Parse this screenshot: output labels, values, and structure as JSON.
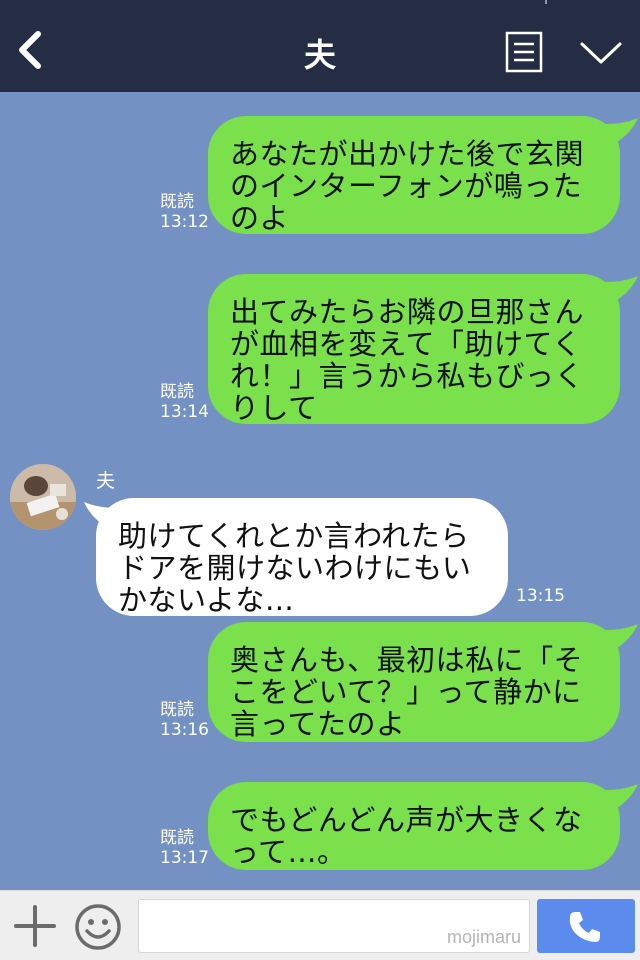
{
  "header": {
    "title": "夫",
    "back_icon": "chevron-left-icon",
    "menu_icon": "notes-menu-icon",
    "collapse_icon": "chevron-down-icon"
  },
  "messages": [
    {
      "direction": "out",
      "text": [
        "あなたが出かけた後で玄関",
        "のインターフォンが鳴った",
        "のよ"
      ],
      "read": "既読",
      "time": "13:12"
    },
    {
      "direction": "out",
      "text": [
        "出てみたらお隣の旦那さん",
        "が血相を変えて「助けてく",
        "れ！」言うから私もびっく",
        "りして"
      ],
      "read": "既読",
      "time": "13:14"
    },
    {
      "direction": "in",
      "sender": "夫",
      "text": [
        "助けてくれとか言われたら",
        "ドアを開けないわけにもい",
        "かないよな…"
      ],
      "time": "13:15"
    },
    {
      "direction": "out",
      "text": [
        "奥さんも、最初は私に「そ",
        "こをどいて？」って静かに",
        "言ってたのよ"
      ],
      "read": "既読",
      "time": "13:16"
    },
    {
      "direction": "out",
      "text": [
        "でもどんどん声が大きくな",
        "って…。"
      ],
      "read": "既読",
      "time": "13:17"
    }
  ],
  "input": {
    "placeholder": "",
    "watermark": "mojimaru",
    "plus_icon": "plus-icon",
    "sticker_icon": "smile-icon",
    "send_icon": "phone-icon"
  },
  "colors": {
    "header": "#252d45",
    "background": "#7391c2",
    "outgoing_bubble": "#7ae04b",
    "incoming_bubble": "#ffffff",
    "call_button": "#5b8bec"
  }
}
